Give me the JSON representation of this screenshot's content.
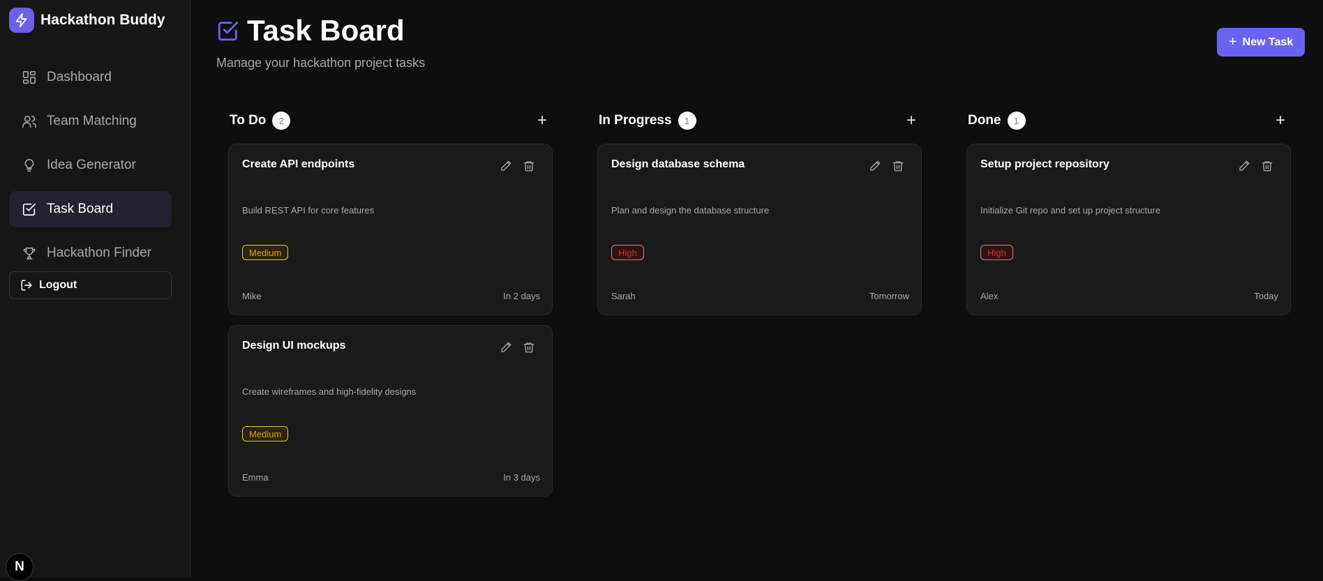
{
  "app": {
    "name": "Hackathon Buddy"
  },
  "sidebar": {
    "items": [
      {
        "label": "Dashboard",
        "icon": "grid-icon",
        "active": false
      },
      {
        "label": "Team Matching",
        "icon": "users-icon",
        "active": false
      },
      {
        "label": "Idea Generator",
        "icon": "lightbulb-icon",
        "active": false
      },
      {
        "label": "Task Board",
        "icon": "check-square-icon",
        "active": true
      },
      {
        "label": "Hackathon Finder",
        "icon": "trophy-icon",
        "active": false
      }
    ],
    "logout_label": "Logout",
    "badge_letter": "N"
  },
  "header": {
    "title": "Task Board",
    "subtitle": "Manage your hackathon project tasks",
    "new_task_label": "New Task"
  },
  "colors": {
    "accent": "#6a63f1",
    "medium": "#d5a41a",
    "high": "#e02828"
  },
  "columns": [
    {
      "title": "To Do",
      "count": "2",
      "cards": [
        {
          "title": "Create API endpoints",
          "description": "Build REST API for core features",
          "priority": "Medium",
          "assignee": "Mike",
          "due": "In 2 days"
        },
        {
          "title": "Design UI mockups",
          "description": "Create wireframes and high-fidelity designs",
          "priority": "Medium",
          "assignee": "Emma",
          "due": "In 3 days"
        }
      ]
    },
    {
      "title": "In Progress",
      "count": "1",
      "cards": [
        {
          "title": "Design database schema",
          "description": "Plan and design the database structure",
          "priority": "High",
          "assignee": "Sarah",
          "due": "Tomorrow"
        }
      ]
    },
    {
      "title": "Done",
      "count": "1",
      "cards": [
        {
          "title": "Setup project repository",
          "description": "Initialize Git repo and set up project structure",
          "priority": "High",
          "assignee": "Alex",
          "due": "Today"
        }
      ]
    }
  ]
}
